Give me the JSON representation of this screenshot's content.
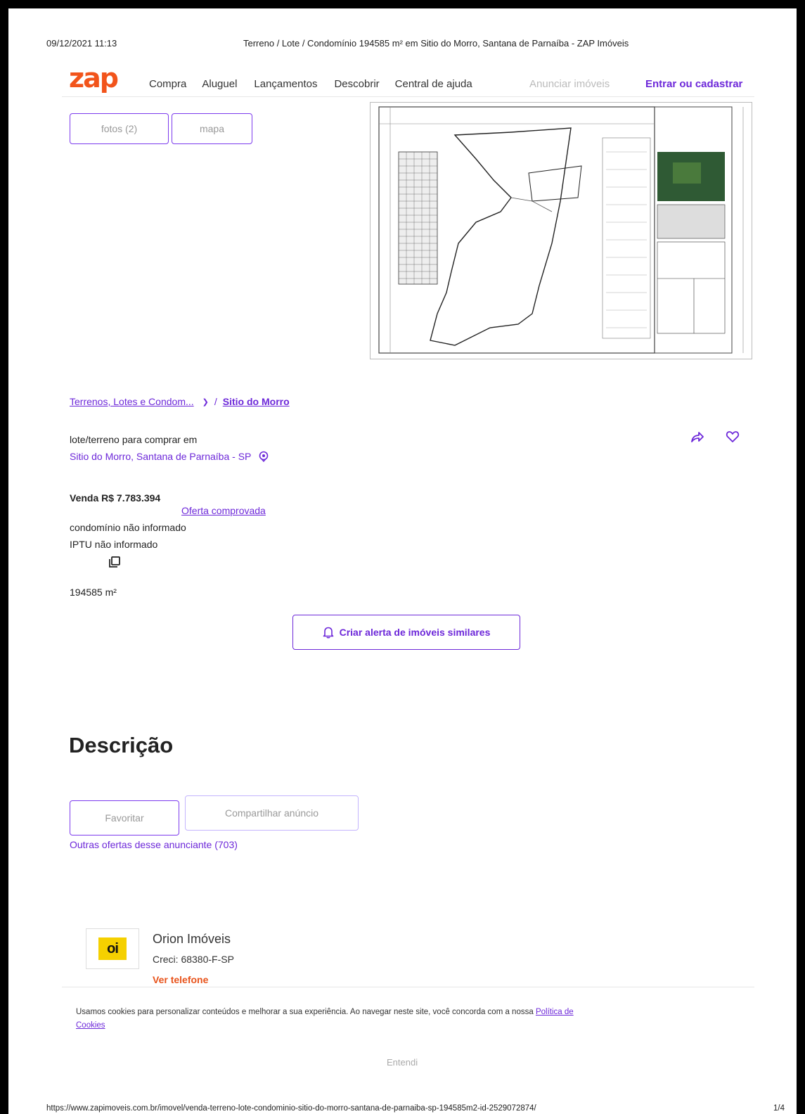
{
  "print_header": {
    "datetime": "09/12/2021 11:13",
    "title": "Terreno / Lote / Condomínio 194585 m² em Sitio do Morro, Santana de Parnaíba - ZAP Imóveis"
  },
  "nav": {
    "logo": "zap",
    "items": [
      "Compra",
      "Aluguel",
      "Lançamentos",
      "Descobrir",
      "Central de ajuda"
    ],
    "announce": "Anunciar imóveis",
    "login": "Entrar ou cadastrar"
  },
  "media": {
    "photos_button": "fotos (2)",
    "map_button": "mapa"
  },
  "breadcrumb": {
    "category": "Terrenos, Lotes e Condom...",
    "separator": "/",
    "location": "Sitio do Morro"
  },
  "listing": {
    "type": "lote/terreno para comprar em",
    "address": "Sitio do Morro, Santana de Parnaíba - SP",
    "price": "Venda R$ 7.783.394",
    "offer_link": "Oferta comprovada",
    "condo": "condomínio não informado",
    "iptu": "IPTU não informado",
    "area": "194585 m²"
  },
  "alert_button": "Criar alerta de imóveis similares",
  "description": {
    "heading": "Descrição"
  },
  "actions": {
    "favorite": "Favoritar",
    "share": "Compartilhar anúncio",
    "other_offers": "Outras ofertas desse anunciante (703)"
  },
  "advertiser": {
    "logo_text": "oi",
    "name": "Orion Imóveis",
    "creci": "Creci: 68380-F-SP",
    "phone_link": "Ver telefone"
  },
  "cookies": {
    "text": "Usamos cookies para personalizar conteúdos e melhorar a sua experiência. Ao navegar neste site, você concorda com a nossa",
    "policy_link_1": "Política de",
    "policy_link_2": "Cookies",
    "accept": "Entendi"
  },
  "print_footer": {
    "url": "https://www.zapimoveis.com.br/imovel/venda-terreno-lote-condominio-sitio-do-morro-santana-de-parnaiba-sp-194585m2-id-2529072874/",
    "page": "1/4"
  },
  "colors": {
    "brand_orange": "#f2541b",
    "accent_purple": "#6d28d9",
    "phone_orange": "#e8531b"
  }
}
